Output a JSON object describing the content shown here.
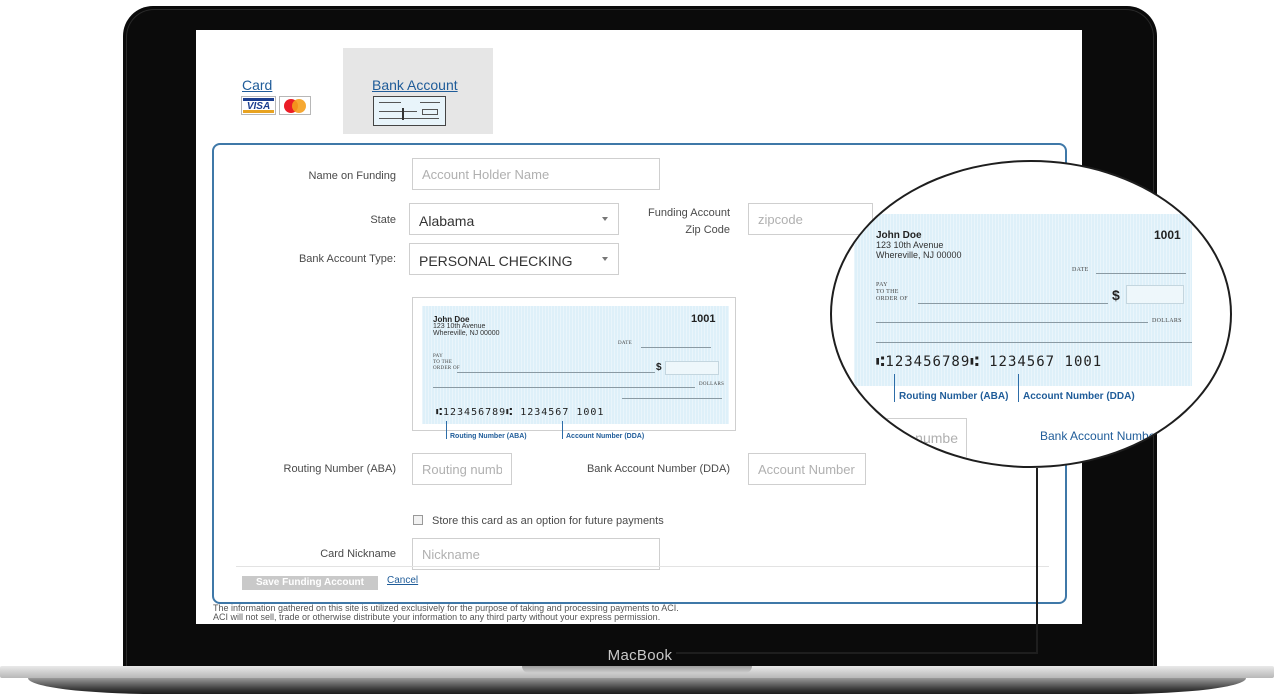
{
  "device": {
    "brand": "MacBook"
  },
  "tabs": {
    "card": {
      "label": "Card",
      "visa_text": "VISA"
    },
    "bank": {
      "label": "Bank Account"
    }
  },
  "form": {
    "name": {
      "label": "Name on Funding",
      "placeholder": "Account Holder Name"
    },
    "state": {
      "label": "State",
      "value": "Alabama"
    },
    "zip": {
      "label_line1": "Funding Account",
      "label_line2": "Zip Code",
      "placeholder": "zipcode"
    },
    "account_type": {
      "label": "Bank Account Type:",
      "value": "PERSONAL CHECKING"
    },
    "routing": {
      "label": "Routing Number (ABA)",
      "placeholder": "Routing number"
    },
    "account_number": {
      "label": "Bank Account Number (DDA)",
      "placeholder": "Account Number"
    },
    "store_label": "Store this card as an option for future payments",
    "nickname": {
      "label": "Card Nickname",
      "placeholder": "Nickname"
    },
    "save_label": "Save Funding Account",
    "cancel_label": "Cancel"
  },
  "check": {
    "name": "John Doe",
    "address1": "123 10th Avenue",
    "address2": "Whereville, NJ 00000",
    "number": "1001",
    "date_label": "Date",
    "pay_line1": "Pay",
    "pay_line2": "To The",
    "pay_line3": "Order Of",
    "dollar_sign": "$",
    "dollars_label": "Dollars",
    "micr": "⑆123456789⑆ 1234567 1001",
    "routing_callout": "Routing Number (ABA)",
    "account_callout": "Account Number (DDA)"
  },
  "magnifier": {
    "partial_field_text": "s numbe",
    "bank_label": "Bank Account Number"
  },
  "disclaimer": {
    "line1": "The information gathered on this site is utilized exclusively for the purpose of taking and processing payments to ACI.",
    "line2": "ACI will not sell, trade or otherwise distribute your information to any third party without your express permission."
  },
  "colors": {
    "accent": "#1f5c99",
    "panel_border": "#3f78a8",
    "check_bg": "#def0f9"
  }
}
